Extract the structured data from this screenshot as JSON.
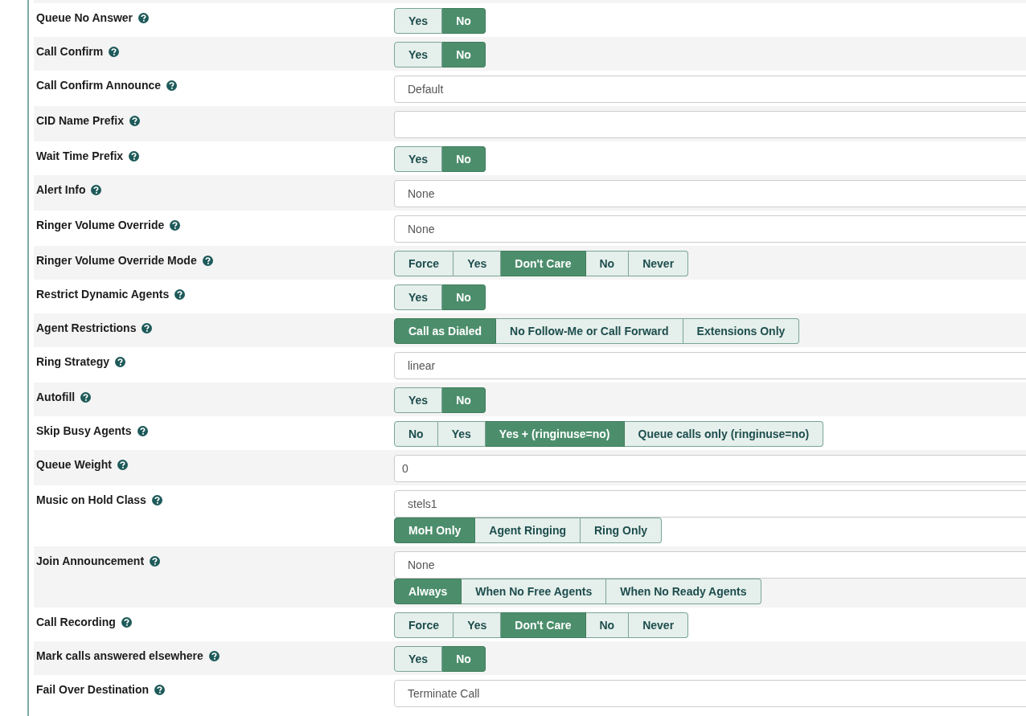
{
  "rows": [
    {
      "label": "Queue No Answer",
      "kind": "toggle",
      "options": [
        {
          "label": "Yes",
          "selected": false
        },
        {
          "label": "No",
          "selected": true
        }
      ]
    },
    {
      "label": "Call Confirm",
      "kind": "toggle",
      "options": [
        {
          "label": "Yes",
          "selected": false
        },
        {
          "label": "No",
          "selected": true
        }
      ]
    },
    {
      "label": "Call Confirm Announce",
      "kind": "select",
      "value": "Default"
    },
    {
      "label": "CID Name Prefix",
      "kind": "input"
    },
    {
      "label": "Wait Time Prefix",
      "kind": "toggle",
      "options": [
        {
          "label": "Yes",
          "selected": false
        },
        {
          "label": "No",
          "selected": true
        }
      ]
    },
    {
      "label": "Alert Info",
      "kind": "select",
      "value": "None"
    },
    {
      "label": "Ringer Volume Override",
      "kind": "select",
      "value": "None"
    },
    {
      "label": "Ringer Volume Override Mode",
      "kind": "toggle",
      "options": [
        {
          "label": "Force",
          "selected": false
        },
        {
          "label": "Yes",
          "selected": false
        },
        {
          "label": "Don't Care",
          "selected": true
        },
        {
          "label": "No",
          "selected": false
        },
        {
          "label": "Never",
          "selected": false
        }
      ]
    },
    {
      "label": "Restrict Dynamic Agents",
      "kind": "toggle",
      "options": [
        {
          "label": "Yes",
          "selected": false
        },
        {
          "label": "No",
          "selected": true
        }
      ]
    },
    {
      "label": "Agent Restrictions",
      "kind": "toggle",
      "options": [
        {
          "label": "Call as Dialed",
          "selected": true
        },
        {
          "label": "No Follow-Me or Call Forward",
          "selected": false
        },
        {
          "label": "Extensions Only",
          "selected": false
        }
      ]
    },
    {
      "label": "Ring Strategy",
      "kind": "select",
      "value": "linear"
    },
    {
      "label": "Autofill",
      "kind": "toggle",
      "options": [
        {
          "label": "Yes",
          "selected": false
        },
        {
          "label": "No",
          "selected": true
        }
      ]
    },
    {
      "label": "Skip Busy Agents",
      "kind": "toggle",
      "options": [
        {
          "label": "No",
          "selected": false
        },
        {
          "label": "Yes",
          "selected": false
        },
        {
          "label": "Yes + (ringinuse=no)",
          "selected": true
        },
        {
          "label": "Queue calls only (ringinuse=no)",
          "selected": false
        }
      ]
    },
    {
      "label": "Queue Weight",
      "kind": "input",
      "value": "0"
    },
    {
      "label": "Music on Hold Class",
      "kind": "select_toggle",
      "value": "stels1",
      "options": [
        {
          "label": "MoH Only",
          "selected": true
        },
        {
          "label": "Agent Ringing",
          "selected": false
        },
        {
          "label": "Ring Only",
          "selected": false
        }
      ]
    },
    {
      "label": "Join Announcement",
      "kind": "select_toggle",
      "value": "None",
      "options": [
        {
          "label": "Always",
          "selected": true
        },
        {
          "label": "When No Free Agents",
          "selected": false
        },
        {
          "label": "When No Ready Agents",
          "selected": false
        }
      ]
    },
    {
      "label": "Call Recording",
      "kind": "toggle",
      "options": [
        {
          "label": "Force",
          "selected": false
        },
        {
          "label": "Yes",
          "selected": false
        },
        {
          "label": "Don't Care",
          "selected": true
        },
        {
          "label": "No",
          "selected": false
        },
        {
          "label": "Never",
          "selected": false
        }
      ]
    },
    {
      "label": "Mark calls answered elsewhere",
      "kind": "toggle",
      "options": [
        {
          "label": "Yes",
          "selected": false
        },
        {
          "label": "No",
          "selected": true
        }
      ]
    },
    {
      "label": "Fail Over Destination",
      "kind": "select",
      "value": "Terminate Call"
    }
  ]
}
